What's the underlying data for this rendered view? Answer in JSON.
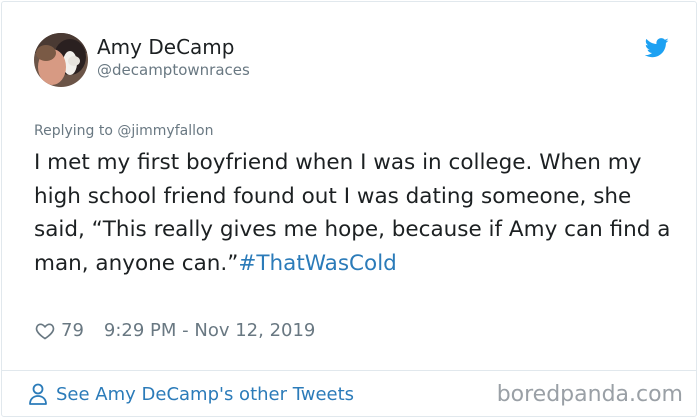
{
  "tweet": {
    "author": {
      "display_name": "Amy DeCamp",
      "handle": "@decamptownraces"
    },
    "reply_to": "Replying to @jimmyfallon",
    "body_text": "I met my first boyfriend when I was in college. When my high school friend found out I was dating someone, she said, “This really gives me hope, because if Amy can find a man, anyone can.”",
    "hashtag": "#ThatWasCold",
    "likes": "79",
    "timestamp": "9:29 PM - Nov 12, 2019",
    "see_more": "See Amy DeCamp's other Tweets"
  },
  "watermark": "boredpanda.com",
  "colors": {
    "link": "#2b7bb9",
    "muted": "#697882",
    "twitter_blue": "#1da1f2"
  },
  "icons": {
    "brand": "twitter-bird-icon",
    "like": "heart-icon",
    "profile": "person-icon"
  }
}
